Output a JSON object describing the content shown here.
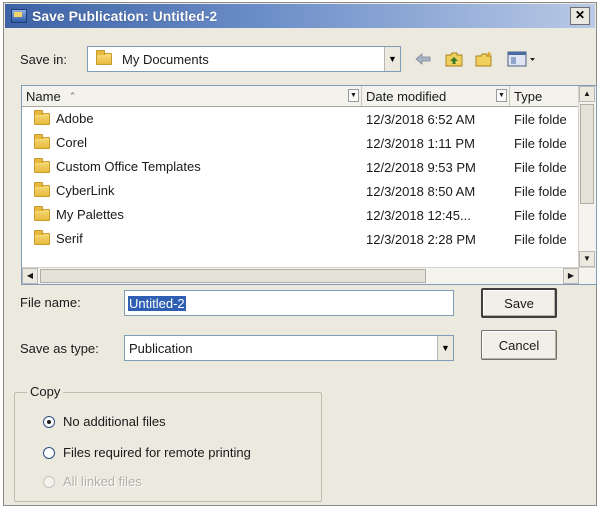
{
  "dialog": {
    "title": "Save Publication: Untitled-2",
    "close_glyph": "✕"
  },
  "save_in": {
    "label": "Save in:",
    "value": "My Documents",
    "icon": "folder-icon"
  },
  "toolbar": {
    "back_icon": "back-arrow-icon",
    "up_icon": "up-folder-icon",
    "new_folder_icon": "new-folder-icon",
    "views_icon": "views-menu-icon"
  },
  "file_list": {
    "columns": [
      "Name",
      "Date modified",
      "Type"
    ],
    "rows": [
      {
        "name": "Adobe",
        "date": "12/3/2018 6:52 AM",
        "type": "File folde"
      },
      {
        "name": "Corel",
        "date": "12/3/2018 1:11 PM",
        "type": "File folde"
      },
      {
        "name": "Custom Office Templates",
        "date": "12/2/2018 9:53 PM",
        "type": "File folde"
      },
      {
        "name": "CyberLink",
        "date": "12/3/2018 8:50 AM",
        "type": "File folde"
      },
      {
        "name": "My Palettes",
        "date": "12/3/2018 12:45...",
        "type": "File folde"
      },
      {
        "name": "Serif",
        "date": "12/3/2018 2:28 PM",
        "type": "File folde"
      }
    ]
  },
  "file_name": {
    "label": "File name:",
    "value": "Untitled-2"
  },
  "save_as_type": {
    "label": "Save as type:",
    "value": "Publication"
  },
  "buttons": {
    "save": "Save",
    "cancel": "Cancel"
  },
  "copy_group": {
    "legend": "Copy",
    "options": [
      {
        "label": "No additional files",
        "selected": true,
        "enabled": true
      },
      {
        "label": "Files required for remote printing",
        "selected": false,
        "enabled": true
      },
      {
        "label": "All linked files",
        "selected": false,
        "enabled": false
      }
    ]
  },
  "colors": {
    "title_gradient_start": "#3d63a6",
    "dialog_bg": "#ece9df",
    "selection": "#2f5fb3",
    "folder_yellow": "#f3cd5b"
  }
}
